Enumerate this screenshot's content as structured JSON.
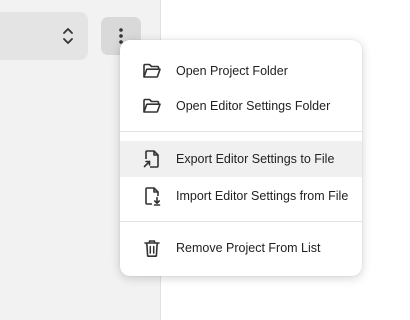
{
  "window": {
    "select_icon": "chevron-up-down-icon",
    "more_icon": "more-vertical-icon"
  },
  "context_menu": {
    "items": [
      {
        "label": "Open Project Folder",
        "icon": "folder-open-icon"
      },
      {
        "label": "Open Editor Settings Folder",
        "icon": "folder-open-icon"
      },
      {
        "label": "Export Editor Settings to File",
        "icon": "file-export-icon",
        "highlighted": true
      },
      {
        "label": "Import Editor Settings from File",
        "icon": "file-import-icon"
      },
      {
        "label": "Remove Project From List",
        "icon": "trash-icon"
      }
    ]
  },
  "colors": {
    "panel_bg": "#f2f2f2",
    "menu_bg": "#ffffff",
    "hover_bg": "#f0f0f0",
    "text": "#222222",
    "icon": "#333333"
  }
}
